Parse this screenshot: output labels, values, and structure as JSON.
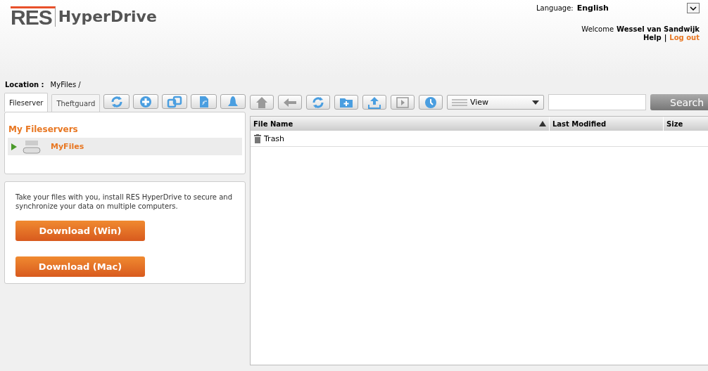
{
  "logo": {
    "mark": "RES",
    "name": "HyperDrive"
  },
  "language": {
    "label": "Language:",
    "value": "English"
  },
  "user": {
    "greeting": "Welcome",
    "name": "Wessel van Sandwijk",
    "help": "Help",
    "separator": "|",
    "logout": "Log out"
  },
  "location": {
    "label": "Location :",
    "path": "MyFiles /"
  },
  "tabs": [
    {
      "label": "Fileserver",
      "selected": true
    },
    {
      "label": "Theftguard",
      "selected": false
    }
  ],
  "tab_tools": [
    {
      "kind": "refresh"
    },
    {
      "kind": "add"
    },
    {
      "kind": "link"
    },
    {
      "kind": "device"
    },
    {
      "kind": "bell"
    }
  ],
  "tree": {
    "title": "My Fileservers",
    "items": [
      {
        "label": "MyFiles",
        "selected": true,
        "expanded": false
      }
    ]
  },
  "promo": {
    "text": "Take your files with you, install RES HyperDrive to secure and synchronize your data on multiple computers.",
    "buttons": [
      "Download (Win)",
      "Download (Mac)"
    ]
  },
  "toolbar": [
    {
      "kind": "home"
    },
    {
      "kind": "back"
    },
    {
      "kind": "refresh"
    },
    {
      "kind": "folder"
    },
    {
      "kind": "upload"
    },
    {
      "kind": "play"
    },
    {
      "kind": "clock"
    }
  ],
  "view": {
    "label": "View"
  },
  "search": {
    "button": "Search"
  },
  "table": {
    "columns": [
      {
        "label": "File Name",
        "sorted": true
      },
      {
        "label": "Last Modified",
        "sorted": false
      },
      {
        "label": "Size",
        "sorted": false
      }
    ],
    "rows": [
      {
        "name": "Trash",
        "kind": "trash"
      }
    ]
  }
}
